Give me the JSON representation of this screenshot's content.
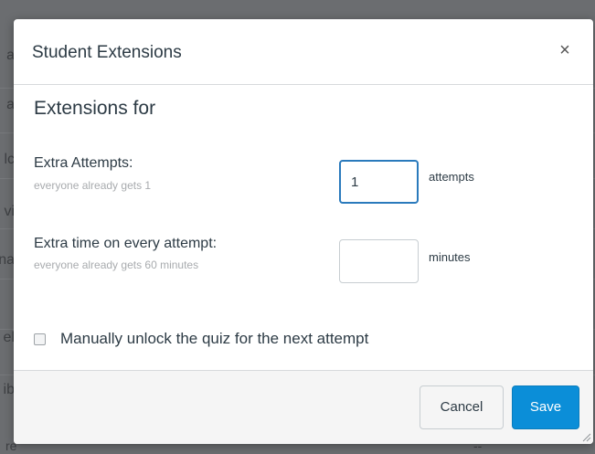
{
  "background": {
    "row_letters": [
      "a",
      "a",
      "lc",
      "vi",
      "na",
      "el",
      "ib"
    ],
    "bottom_left_text": "re",
    "bottom_right_text": "--"
  },
  "dialog": {
    "title": "Student Extensions",
    "close_label": "×",
    "heading": "Extensions for",
    "extra_attempts": {
      "label": "Extra Attempts:",
      "hint": "everyone already gets 1",
      "value": "1",
      "unit": "attempts"
    },
    "extra_time": {
      "label": "Extra time on every attempt:",
      "hint": "everyone already gets 60 minutes",
      "value": "",
      "unit": "minutes"
    },
    "manual_unlock": {
      "label": "Manually unlock the quiz for the next attempt",
      "checked": false
    },
    "buttons": {
      "cancel": "Cancel",
      "save": "Save"
    }
  },
  "colors": {
    "save_button": "#0b8ed8",
    "focus_border": "#2a7abc",
    "text": "#2d3b45",
    "hint": "#a8abae"
  }
}
